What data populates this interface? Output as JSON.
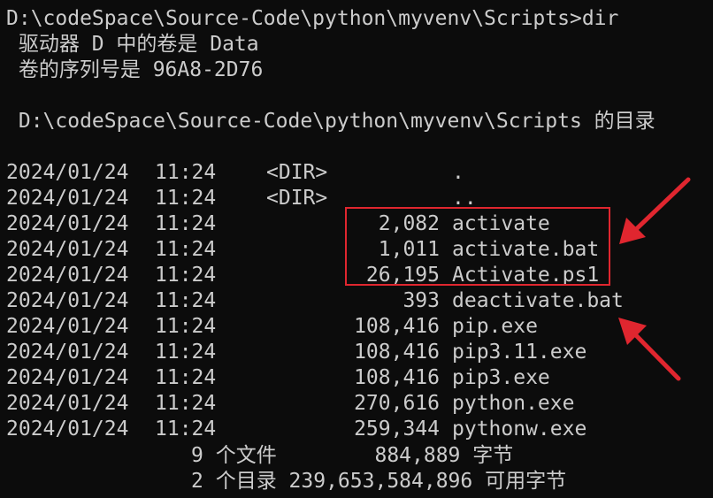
{
  "terminal": {
    "prompt": "D:\\codeSpace\\Source-Code\\python\\myvenv\\Scripts>dir",
    "volume_line": " 驱动器 D 中的卷是 Data",
    "serial_line": " 卷的序列号是 96A8-2D76",
    "dir_header": " D:\\codeSpace\\Source-Code\\python\\myvenv\\Scripts 的目录"
  },
  "entries": [
    {
      "date": "2024/01/24",
      "time": "11:24",
      "dir": "<DIR>",
      "size": "",
      "name": "."
    },
    {
      "date": "2024/01/24",
      "time": "11:24",
      "dir": "<DIR>",
      "size": "",
      "name": ".."
    },
    {
      "date": "2024/01/24",
      "time": "11:24",
      "dir": "",
      "size": "2,082",
      "name": "activate"
    },
    {
      "date": "2024/01/24",
      "time": "11:24",
      "dir": "",
      "size": "1,011",
      "name": "activate.bat"
    },
    {
      "date": "2024/01/24",
      "time": "11:24",
      "dir": "",
      "size": "26,195",
      "name": "Activate.ps1"
    },
    {
      "date": "2024/01/24",
      "time": "11:24",
      "dir": "",
      "size": "393",
      "name": "deactivate.bat"
    },
    {
      "date": "2024/01/24",
      "time": "11:24",
      "dir": "",
      "size": "108,416",
      "name": "pip.exe"
    },
    {
      "date": "2024/01/24",
      "time": "11:24",
      "dir": "",
      "size": "108,416",
      "name": "pip3.11.exe"
    },
    {
      "date": "2024/01/24",
      "time": "11:24",
      "dir": "",
      "size": "108,416",
      "name": "pip3.exe"
    },
    {
      "date": "2024/01/24",
      "time": "11:24",
      "dir": "",
      "size": "270,616",
      "name": "python.exe"
    },
    {
      "date": "2024/01/24",
      "time": "11:24",
      "dir": "",
      "size": "259,344",
      "name": "pythonw.exe"
    }
  ],
  "summary": {
    "files_line": "9 个文件        884,889 字节",
    "dirs_line": "2 个目录 239,653,584,896 可用字节"
  },
  "annotations": {
    "box_color": "#e0262f",
    "arrow_color": "#e0262f"
  },
  "colors": {
    "background": "#0c0c0c",
    "text": "#cccccc"
  }
}
